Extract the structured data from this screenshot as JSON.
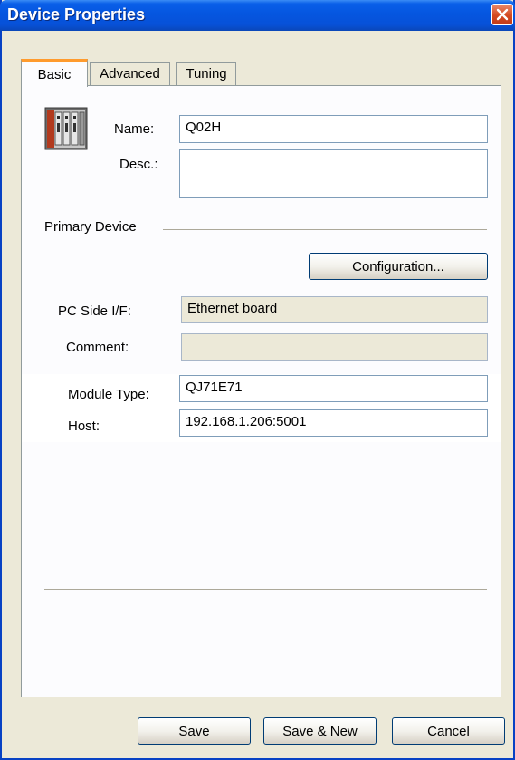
{
  "window": {
    "title": "Device Properties",
    "close_glyph": "✕"
  },
  "tabs": [
    {
      "label": "Basic",
      "active": true
    },
    {
      "label": "Advanced",
      "active": false
    },
    {
      "label": "Tuning",
      "active": false
    }
  ],
  "basic": {
    "name_label": "Name:",
    "name_value": "Q02H",
    "desc_label": "Desc.:",
    "desc_value": "",
    "primary_device_label": "Primary Device",
    "configuration_button": "Configuration...",
    "pc_side_label": "PC Side I/F:",
    "pc_side_value": "Ethernet board",
    "comment_label": "Comment:",
    "comment_value": "",
    "module_type_label": "Module Type:",
    "module_type_value": "QJ71E71",
    "host_label": "Host:",
    "host_value": "192.168.1.206:5001"
  },
  "buttons": {
    "save": "Save",
    "save_new": "Save & New",
    "cancel": "Cancel"
  },
  "colors": {
    "titlebar": "#0556e0",
    "active_tab_accent": "#ff9b2d",
    "dialog_bg": "#ece9d8"
  },
  "icons": {
    "device": "plc-rack-icon",
    "close": "close-icon"
  }
}
